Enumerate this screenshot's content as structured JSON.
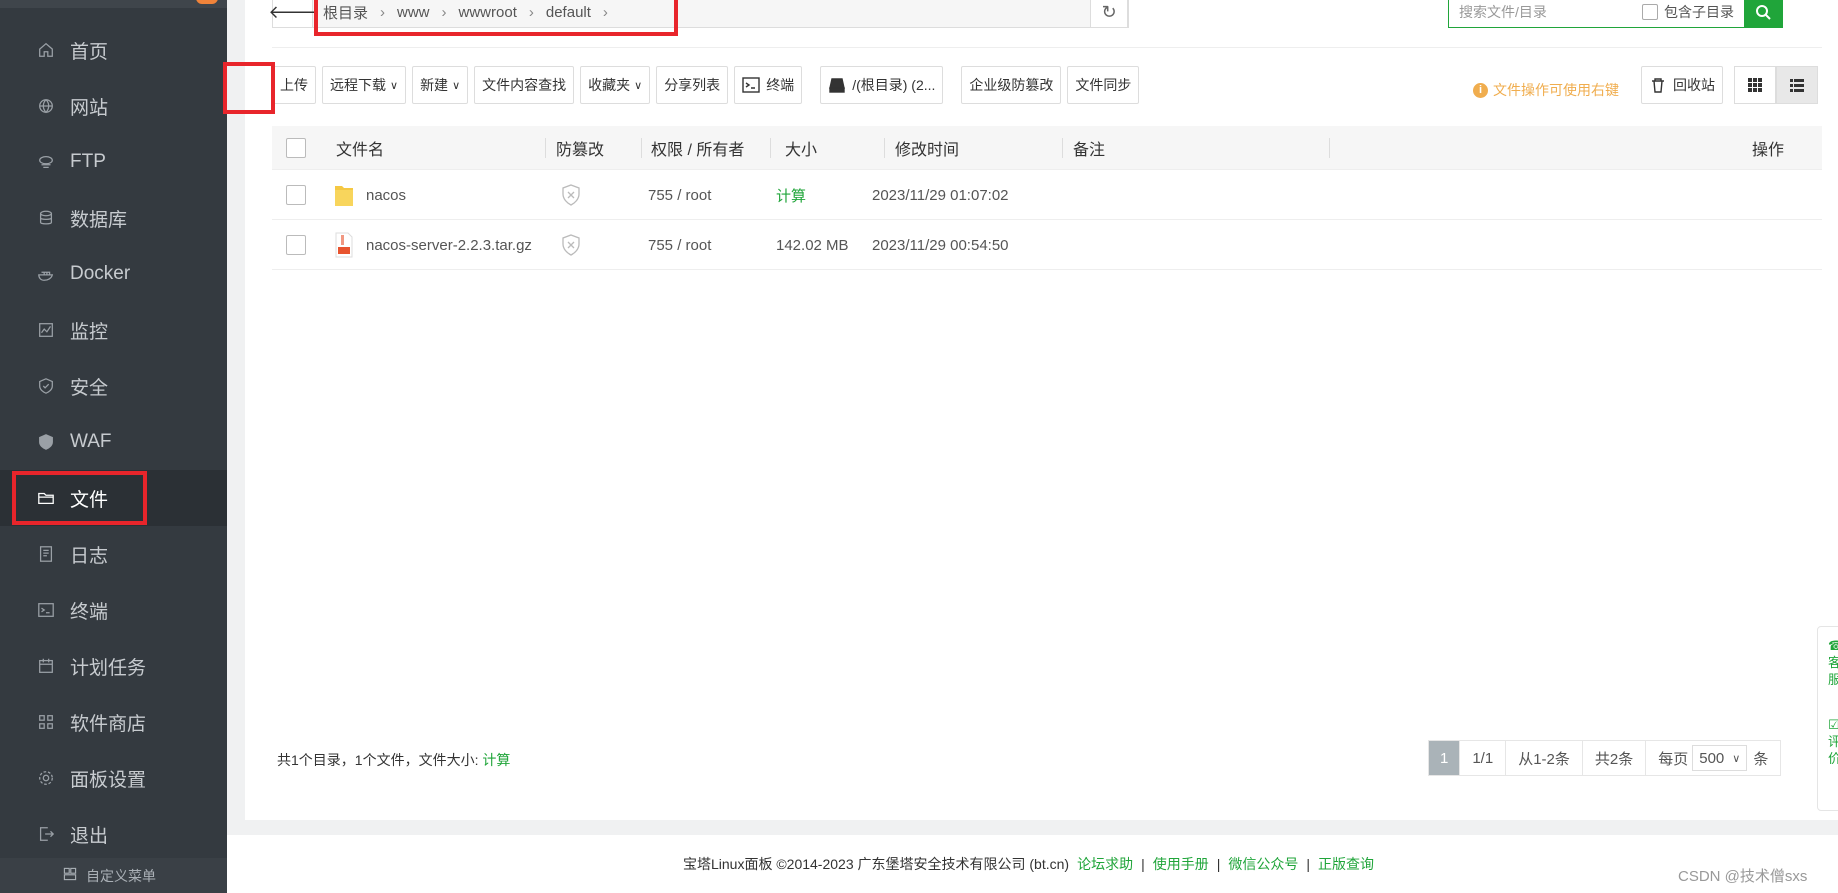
{
  "sidebar": {
    "items": [
      {
        "label": "首页",
        "icon": "home-icon"
      },
      {
        "label": "网站",
        "icon": "globe-icon"
      },
      {
        "label": "FTP",
        "icon": "ftp-icon"
      },
      {
        "label": "数据库",
        "icon": "database-icon"
      },
      {
        "label": "Docker",
        "icon": "docker-icon"
      },
      {
        "label": "监控",
        "icon": "monitor-icon"
      },
      {
        "label": "安全",
        "icon": "shield-icon"
      },
      {
        "label": "WAF",
        "icon": "waf-icon"
      },
      {
        "label": "文件",
        "icon": "folder-icon"
      },
      {
        "label": "日志",
        "icon": "log-icon"
      },
      {
        "label": "终端",
        "icon": "terminal-icon"
      },
      {
        "label": "计划任务",
        "icon": "calendar-icon"
      },
      {
        "label": "软件商店",
        "icon": "apps-icon"
      },
      {
        "label": "面板设置",
        "icon": "settings-icon"
      },
      {
        "label": "退出",
        "icon": "logout-icon"
      }
    ],
    "active": "文件",
    "custom_menu": "自定义菜单"
  },
  "path": {
    "crumbs": [
      "根目录",
      "www",
      "wwwroot",
      "default"
    ]
  },
  "search": {
    "placeholder": "搜索文件/目录",
    "include_sub": "包含子目录"
  },
  "toolbar": {
    "upload": "上传",
    "remote_download": "远程下载",
    "new": "新建",
    "content_search": "文件内容查找",
    "favorites": "收藏夹",
    "share_list": "分享列表",
    "terminal": "终端",
    "disk": "/(根目录) (2...",
    "tamper": "企业级防篡改",
    "sync": "文件同步",
    "tip": "文件操作可使用右键",
    "recycle": "回收站"
  },
  "table": {
    "headers": {
      "name": "文件名",
      "tamper": "防篡改",
      "perm": "权限 / 所有者",
      "size": "大小",
      "mtime": "修改时间",
      "note": "备注",
      "ops": "操作"
    },
    "rows": [
      {
        "name": "nacos",
        "type": "folder",
        "perm": "755 / root",
        "size": "计算",
        "mtime": "2023/11/29 01:07:02"
      },
      {
        "name": "nacos-server-2.2.3.tar.gz",
        "type": "archive",
        "perm": "755 / root",
        "size": "142.02 MB",
        "mtime": "2023/11/29 00:54:50"
      }
    ]
  },
  "summary": {
    "text": "共1个目录，1个文件，文件大小: ",
    "calc": "计算"
  },
  "pager": {
    "current": "1",
    "pages": "1/1",
    "range": "从1-2条",
    "total": "共2条",
    "per_page_label": "每页",
    "per_page": "500",
    "unit": "条"
  },
  "footer": {
    "copyright": "宝塔Linux面板 ©2014-2023 广东堡塔安全技术有限公司 (bt.cn)",
    "links": [
      "论坛求助",
      "使用手册",
      "微信公众号",
      "正版查询"
    ]
  },
  "float_panel": {
    "text1": "客服",
    "text2": "评价"
  },
  "watermark": "CSDN @技术僧sxs",
  "colors": {
    "accent": "#20a53a",
    "sidebar_bg": "#343a40",
    "highlight": "#e8252b",
    "tip": "#f0ad4e"
  }
}
